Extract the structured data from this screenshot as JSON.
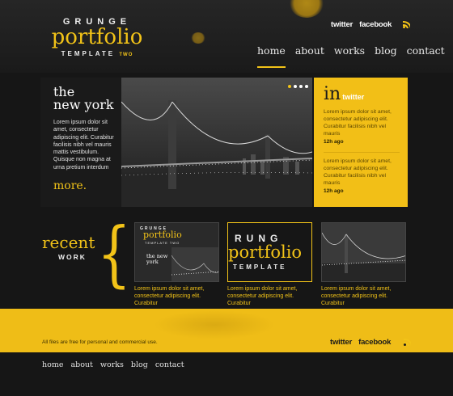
{
  "logo": {
    "line1": "GRUNGE",
    "line2": "portfolio",
    "line3": "TEMPLATE",
    "line3_suffix": "TWO"
  },
  "social": {
    "twitter": "twitter",
    "facebook": "facebook",
    "rss_icon": "rss-icon"
  },
  "nav": [
    "home",
    "about",
    "works",
    "blog",
    "contact"
  ],
  "nav_active": "home",
  "hero": {
    "title_line1": "the",
    "title_line2": "new york",
    "body": "Lorem ipsum dolor sit amet, consectetur adipiscing elit. Curabitur facilisis nibh vel mauris mattis vestibulum. Quisque non magna at urna pretium interdum",
    "more": "more.",
    "slide_count": 4
  },
  "twitter_box": {
    "in_label": "in",
    "brand": "twitter",
    "tweets": [
      {
        "text": "Lorem ipsum dolor sit amet, consectetur adipiscing elit. Curabitur facilisis nibh vel mauris",
        "ago": "12h ago"
      },
      {
        "text": "Lorem ipsum dolor sit amet, consectetur adipiscing elit. Curabitur facilisis nibh vel mauris",
        "ago": "12h ago"
      }
    ]
  },
  "recent": {
    "line1": "recent",
    "line2": "WORK",
    "brace": "{",
    "items": [
      {
        "caption": "Lorem ipsum dolor sit amet, consectetur adipiscing elit. Curabitur",
        "thumb_text_1": "GRUNGE",
        "thumb_text_2": "portfolio",
        "thumb_text_3": "TEMPLATE TWO",
        "thumb_text_4": "the new york"
      },
      {
        "caption": "Lorem ipsum dolor sit amet, consectetur adipiscing elit. Curabitur",
        "thumb_text_1": "RUNG",
        "thumb_text_2": "portfolio",
        "thumb_text_3": "TEMPLATE"
      },
      {
        "caption": "Lorem ipsum dolor sit amet, consectetur adipiscing elit. Curabitur"
      }
    ]
  },
  "footer": {
    "note": "All files are free for personal and commercial use.",
    "twitter": "twitter",
    "facebook": "facebook",
    "nav": [
      "home",
      "about",
      "works",
      "blog",
      "contact"
    ]
  },
  "colors": {
    "accent": "#f2c318",
    "background": "#161616",
    "footer_band": "#efbd17"
  }
}
